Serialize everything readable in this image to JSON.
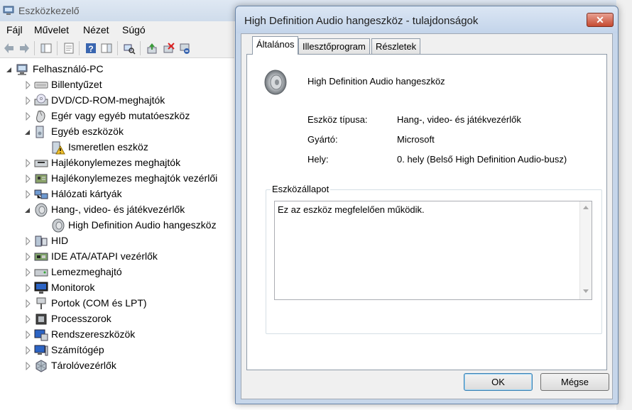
{
  "device_manager": {
    "title": "Eszközkezelő",
    "menu": [
      "Fájl",
      "Művelet",
      "Nézet",
      "Súgó"
    ],
    "tree": {
      "root": "Felhasználó-PC",
      "items": [
        {
          "label": "Billentyűzet",
          "icon": "keyboard-icon",
          "expanded": false
        },
        {
          "label": "DVD/CD-ROM-meghajtók",
          "icon": "dvd-drive-icon",
          "expanded": false
        },
        {
          "label": "Egér vagy egyéb mutatóeszköz",
          "icon": "mouse-icon",
          "expanded": false
        },
        {
          "label": "Egyéb eszközök",
          "icon": "other-devices-icon",
          "expanded": true
        },
        {
          "label": "Ismeretlen eszköz",
          "icon": "unknown-device-warning-icon",
          "child": true
        },
        {
          "label": "Hajlékonylemezes meghajtók",
          "icon": "floppy-drive-icon",
          "expanded": false
        },
        {
          "label": "Hajlékonylemezes meghajtók vezérlői",
          "icon": "floppy-controller-icon",
          "expanded": false
        },
        {
          "label": "Hálózati kártyák",
          "icon": "network-adapter-icon",
          "expanded": false
        },
        {
          "label": "Hang-, video- és játékvezérlők",
          "icon": "sound-controller-icon",
          "expanded": true
        },
        {
          "label": "High Definition Audio hangeszköz",
          "icon": "speaker-icon",
          "child": true
        },
        {
          "label": "HID",
          "icon": "hid-icon",
          "expanded": false
        },
        {
          "label": "IDE ATA/ATAPI vezérlők",
          "icon": "ide-controller-icon",
          "expanded": false
        },
        {
          "label": "Lemezmeghajtó",
          "icon": "disk-drive-icon",
          "expanded": false
        },
        {
          "label": "Monitorok",
          "icon": "monitor-icon",
          "expanded": false
        },
        {
          "label": "Portok (COM és LPT)",
          "icon": "port-icon",
          "expanded": false
        },
        {
          "label": "Processzorok",
          "icon": "processor-icon",
          "expanded": false
        },
        {
          "label": "Rendszereszközök",
          "icon": "system-devices-icon",
          "expanded": false
        },
        {
          "label": "Számítógép",
          "icon": "computer-icon",
          "expanded": false
        },
        {
          "label": "Tárolóvezérlők",
          "icon": "storage-controller-icon",
          "expanded": false
        }
      ]
    }
  },
  "dialog": {
    "title": "High Definition Audio hangeszköz - tulajdonságok",
    "close_label": "✕",
    "tabs": [
      "Általános",
      "Illesztőprogram",
      "Részletek"
    ],
    "active_tab": "Általános",
    "device_name": "High Definition Audio hangeszköz",
    "properties": [
      {
        "label": "Eszköz típusa:",
        "value": "Hang-, video- és játékvezérlők"
      },
      {
        "label": "Gyártó:",
        "value": "Microsoft"
      },
      {
        "label": "Hely:",
        "value": "0. hely (Belső High Definition Audio-busz)"
      }
    ],
    "status_group_label": "Eszközállapot",
    "status_text": "Ez az eszköz megfelelően működik.",
    "ok_label": "OK",
    "cancel_label": "Mégse"
  },
  "colors": {
    "titlebar": "#cfdceb",
    "close_button": "#c54a31",
    "dialog_frame": "#c6d6ea",
    "panel_bg": "#f0f0f0",
    "tree_arrow": "#6d6d6d"
  }
}
